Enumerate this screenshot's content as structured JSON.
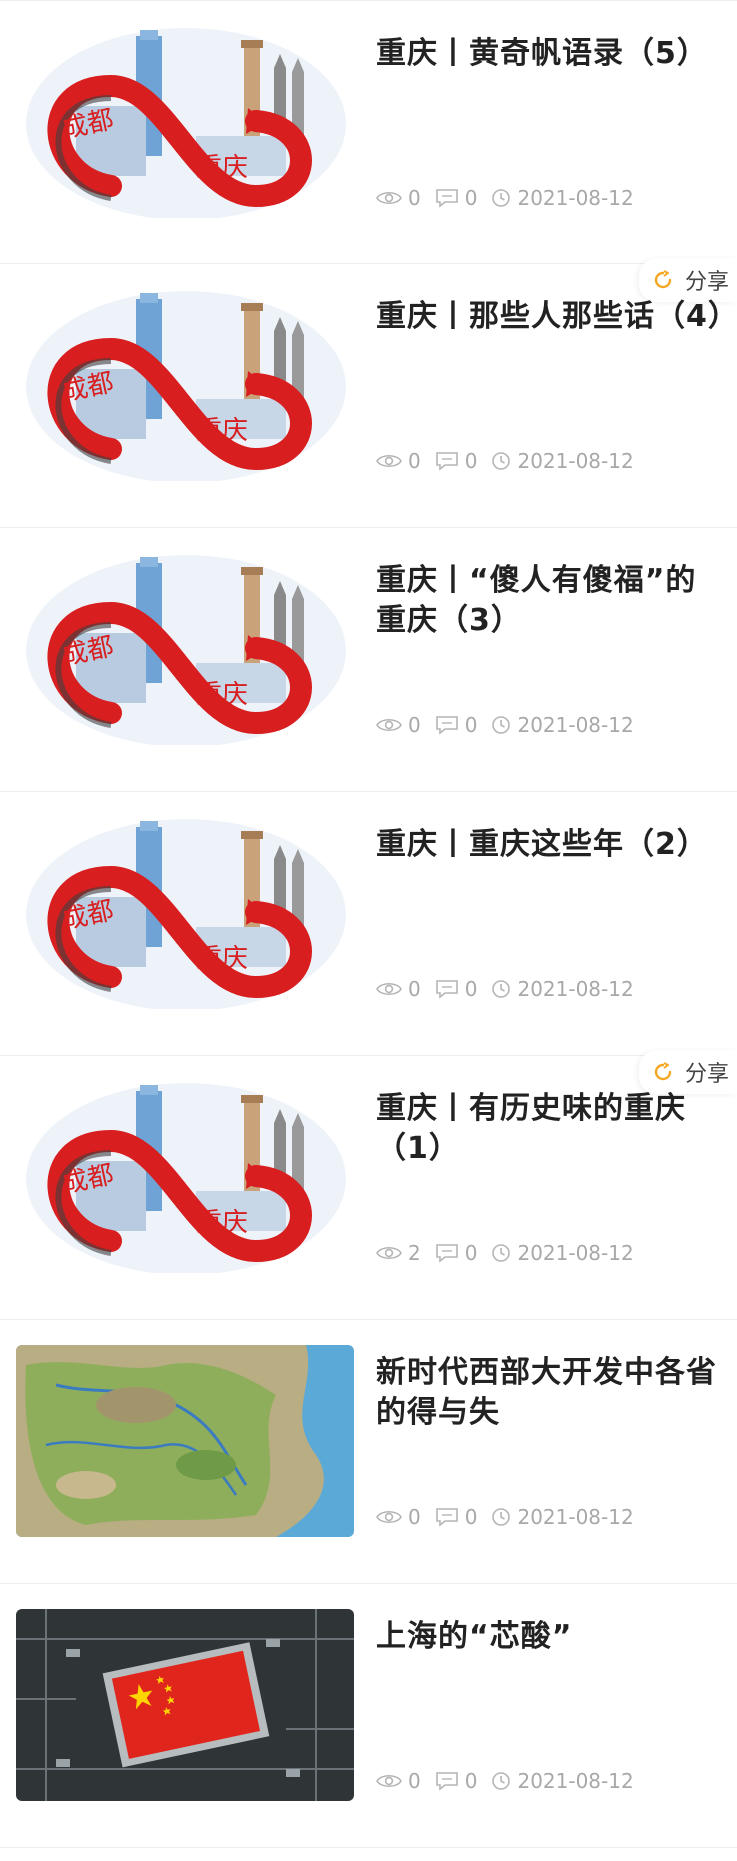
{
  "articles": [
    {
      "title": "重庆丨黄奇帆语录（5）",
      "views": "0",
      "comments": "0",
      "date": "2021-08-12",
      "image": "chengdu-chongqing-cover",
      "share": ""
    },
    {
      "title": "重庆丨那些人那些话（4）",
      "views": "0",
      "comments": "0",
      "date": "2021-08-12",
      "image": "chengdu-chongqing-cover",
      "share": "分享"
    },
    {
      "title": "重庆丨“傻人有傻福”的重庆（3）",
      "views": "0",
      "comments": "0",
      "date": "2021-08-12",
      "image": "chengdu-chongqing-cover",
      "share": ""
    },
    {
      "title": "重庆丨重庆这些年（2）",
      "views": "0",
      "comments": "0",
      "date": "2021-08-12",
      "image": "chengdu-chongqing-cover",
      "share": ""
    },
    {
      "title": "重庆丨有历史味的重庆（1）",
      "views": "2",
      "comments": "0",
      "date": "2021-08-12",
      "image": "chengdu-chongqing-cover",
      "share": "分享"
    },
    {
      "title": "新时代西部大开发中各省的得与失",
      "views": "0",
      "comments": "0",
      "date": "2021-08-12",
      "image": "china-map",
      "share": ""
    },
    {
      "title": "上海的“芯酸”",
      "views": "0",
      "comments": "0",
      "date": "2021-08-12",
      "image": "china-flag-chip",
      "share": ""
    }
  ],
  "thumb_text": {
    "city_a": "成都",
    "city_b": "重庆"
  },
  "colors": {
    "title": "#222222",
    "meta": "#a8a8a8",
    "share_icon": "#f5a623",
    "ribbon": "#d81e1e"
  },
  "icons": {
    "views": "eye-icon",
    "comments": "comment-icon",
    "date": "clock-icon",
    "share": "share-icon"
  }
}
